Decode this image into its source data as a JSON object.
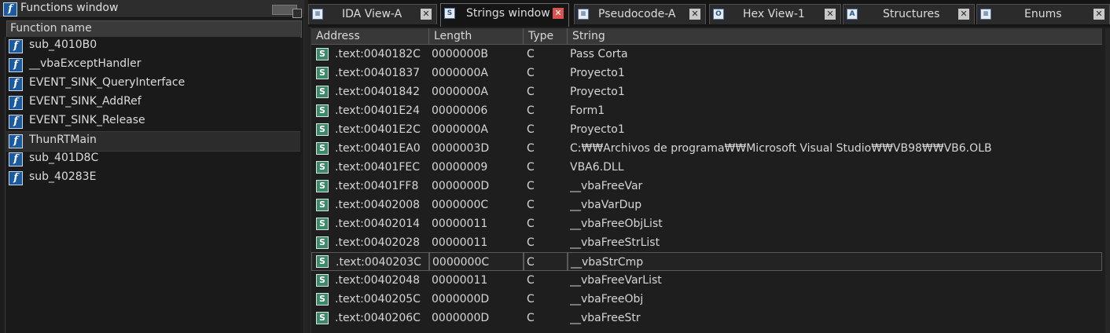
{
  "functions_window": {
    "title": "Functions window",
    "column_header": "Function name",
    "items": [
      {
        "name": "sub_4010B0"
      },
      {
        "name": "__vbaExceptHandler"
      },
      {
        "name": "EVENT_SINK_QueryInterface"
      },
      {
        "name": "EVENT_SINK_AddRef"
      },
      {
        "name": "EVENT_SINK_Release"
      },
      {
        "name": "ThunRTMain",
        "selected": true
      },
      {
        "name": "sub_401D8C"
      },
      {
        "name": "sub_40283E"
      }
    ]
  },
  "tabs": [
    {
      "label": "IDA View-A",
      "icon": "graph-icon",
      "glyph": "≡",
      "active": false,
      "close_style": "gray"
    },
    {
      "label": "Strings window",
      "icon": "strings-icon",
      "glyph": "S",
      "active": true,
      "close_style": "red"
    },
    {
      "label": "Pseudocode-A",
      "icon": "pseudocode-icon",
      "glyph": "≡",
      "active": false,
      "close_style": "gray"
    },
    {
      "label": "Hex View-1",
      "icon": "hex-icon",
      "glyph": "O",
      "active": false,
      "close_style": "gray"
    },
    {
      "label": "Structures",
      "icon": "structures-icon",
      "glyph": "A",
      "active": false,
      "close_style": "gray"
    },
    {
      "label": "Enums",
      "icon": "enums-icon",
      "glyph": "≡",
      "active": false,
      "close_style": "gray"
    }
  ],
  "strings_table": {
    "columns": [
      "Address",
      "Length",
      "Type",
      "String"
    ],
    "rows": [
      {
        "address": ".text:0040182C",
        "length": "0000000B",
        "type": "C",
        "string": "Pass Corta"
      },
      {
        "address": ".text:00401837",
        "length": "0000000A",
        "type": "C",
        "string": "Proyecto1"
      },
      {
        "address": ".text:00401842",
        "length": "0000000A",
        "type": "C",
        "string": "Proyecto1"
      },
      {
        "address": ".text:00401E24",
        "length": "00000006",
        "type": "C",
        "string": "Form1"
      },
      {
        "address": ".text:00401E2C",
        "length": "0000000A",
        "type": "C",
        "string": "Proyecto1"
      },
      {
        "address": ".text:00401EA0",
        "length": "0000003D",
        "type": "C",
        "string": "C:₩₩Archivos de programa₩₩Microsoft Visual Studio₩₩VB98₩₩VB6.OLB"
      },
      {
        "address": ".text:00401FEC",
        "length": "00000009",
        "type": "C",
        "string": "VBA6.DLL"
      },
      {
        "address": ".text:00401FF8",
        "length": "0000000D",
        "type": "C",
        "string": "__vbaFreeVar"
      },
      {
        "address": ".text:00402008",
        "length": "0000000C",
        "type": "C",
        "string": "__vbaVarDup"
      },
      {
        "address": ".text:00402014",
        "length": "00000011",
        "type": "C",
        "string": "__vbaFreeObjList"
      },
      {
        "address": ".text:00402028",
        "length": "00000011",
        "type": "C",
        "string": "__vbaFreeStrList"
      },
      {
        "address": ".text:0040203C",
        "length": "0000000C",
        "type": "C",
        "string": "__vbaStrCmp",
        "selected": true
      },
      {
        "address": ".text:00402048",
        "length": "00000011",
        "type": "C",
        "string": "__vbaFreeVarList"
      },
      {
        "address": ".text:0040205C",
        "length": "0000000D",
        "type": "C",
        "string": "__vbaFreeObj"
      },
      {
        "address": ".text:0040206C",
        "length": "0000000D",
        "type": "C",
        "string": "__vbaFreeStr"
      }
    ]
  },
  "colors": {
    "background": "#1e1e1e",
    "function_icon": "#1a5a9e",
    "string_icon": "#3d8a6a",
    "close_active": "#d9534f"
  }
}
